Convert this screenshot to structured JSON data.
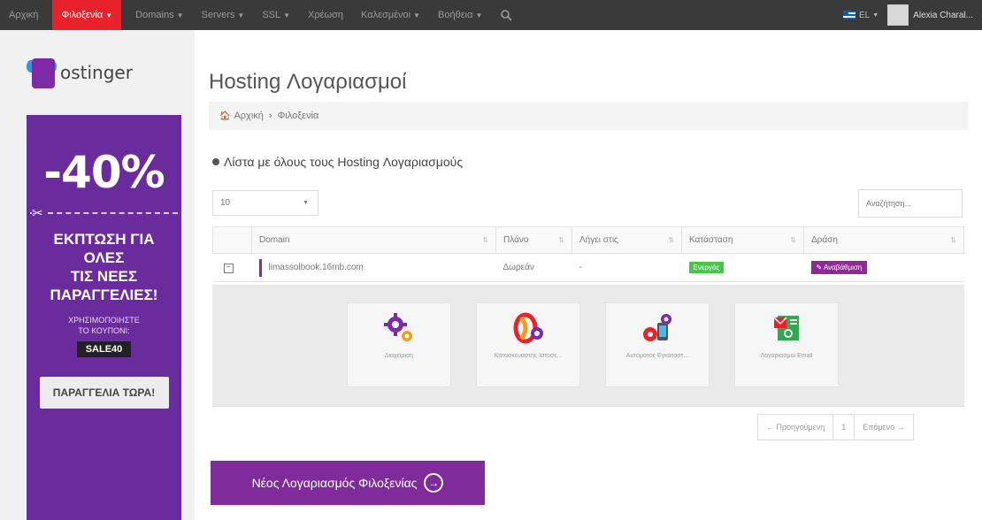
{
  "topnav": {
    "items": [
      {
        "label": "Αρχική",
        "active": false
      },
      {
        "label": "Φιλοξενία",
        "active": true,
        "dropdown": true
      },
      {
        "label": "Domains",
        "active": false,
        "dropdown": true
      },
      {
        "label": "Servers",
        "active": false,
        "dropdown": true
      },
      {
        "label": "SSL",
        "active": false,
        "dropdown": true
      },
      {
        "label": "Χρέωση",
        "active": false
      },
      {
        "label": "Καλεσμένοι",
        "active": false,
        "dropdown": true
      },
      {
        "label": "Βοήθεια",
        "active": false,
        "dropdown": true
      }
    ],
    "search_icon": "search-icon",
    "language": "EL",
    "user_name": "Alexia Charal..."
  },
  "sidebar": {
    "logo_text": "ostinger",
    "promo": {
      "discount": "-40%",
      "headline_lines": [
        "ΕΚΠΤΩΣΗ ΓΙΑ",
        "ΟΛΕΣ",
        "ΤΙΣ ΝΕΕΣ",
        "ΠΑΡΑΓΓΕΛΙΕΣ!"
      ],
      "coupon_label_lines": [
        "ΧΡΗΣΙΜΟΠΟΙΗΣΤΕ",
        "ΤΟ ΚΟΥΠΟΝΙ:"
      ],
      "code": "SALE40",
      "order_button": "ΠΑΡΑΓΓΕΛΙΑ ΤΩΡΑ!"
    }
  },
  "main": {
    "title": "Hosting Λογαριασμοί",
    "breadcrumb": {
      "home": "Αρχική",
      "sep": "›",
      "current": "Φιλοξενία"
    },
    "section_title": "Λίστα με όλους τους Hosting Λογαριασμούς",
    "page_length": "10",
    "search_placeholder": "Αναζήτηση...",
    "table": {
      "columns": [
        "Domain",
        "Πλάνο",
        "Λήγει στις",
        "Κατάσταση",
        "Δράση"
      ],
      "rows": [
        {
          "domain": "limassolbook.16mb.com",
          "plan": "Δωρεάν",
          "expires": "-",
          "status": "Ενεργός",
          "action": "Αναβάθμιση"
        }
      ]
    },
    "tiles": [
      {
        "label": "Διαχείριση",
        "icon": "gears-icon"
      },
      {
        "label": "Κατασκευαστής Ιστοσε...",
        "icon": "website-builder-icon"
      },
      {
        "label": "Αυτόματος Εγκαταστ...",
        "icon": "auto-installer-icon"
      },
      {
        "label": "Λογαριασμοί Email",
        "icon": "email-accounts-icon"
      }
    ],
    "pagination": {
      "prev": "← Προηγούμενη",
      "page": "1",
      "next": "Επόμενο →"
    },
    "new_account_button": "Νέος Λογαριασμός Φιλοξενίας"
  },
  "colors": {
    "topnav_bg": "#3a3a3a",
    "active_nav": "#e8222a",
    "brand_purple": "#7f2b9b",
    "status_green": "#47c549"
  }
}
